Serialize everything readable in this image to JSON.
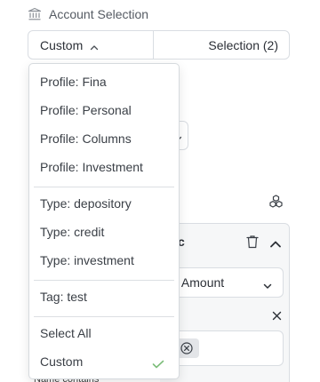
{
  "header": {
    "title": "Account Selection",
    "icon": "bank-icon"
  },
  "selector": {
    "left_label": "Custom",
    "right_label": "Selection (2)"
  },
  "metric": {
    "title_partial": "tric",
    "select_value_partial": "tal Amount"
  },
  "filter_peek_label": "Name contains",
  "menu": {
    "groups": [
      [
        "Profile: Fina",
        "Profile: Personal",
        "Profile: Columns",
        "Profile: Investment"
      ],
      [
        "Type: depository",
        "Type: credit",
        "Type: investment"
      ],
      [
        "Tag: test"
      ],
      [
        "Select All",
        "Custom"
      ]
    ],
    "selected": "Custom"
  },
  "colors": {
    "border": "#d9dde2",
    "check": "#7dbd7a",
    "text": "#2b2f36",
    "muted": "#555b63"
  }
}
